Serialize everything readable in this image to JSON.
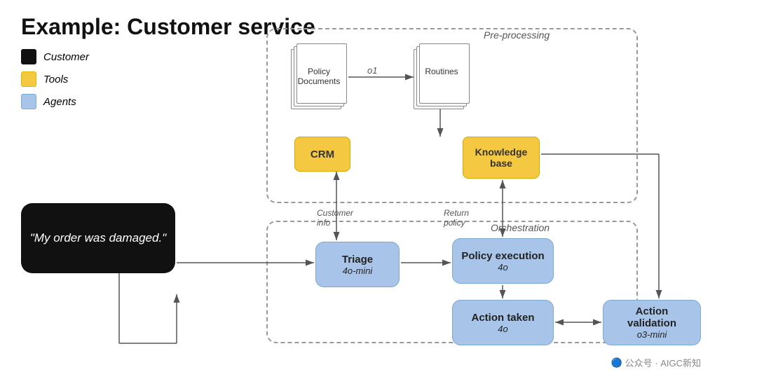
{
  "title": "Example: Customer service",
  "legend": {
    "items": [
      {
        "label": "Customer",
        "color": "black"
      },
      {
        "label": "Tools",
        "color": "yellow"
      },
      {
        "label": "Agents",
        "color": "blue"
      }
    ]
  },
  "customer_message": "\"My order was damaged.\"",
  "preprocessing_label": "Pre-processing",
  "orchestration_label": "Orchestration",
  "policy_documents_label": "Policy\nDocuments",
  "routines_label": "Routines",
  "o1_label": "o1",
  "crm_label": "CRM",
  "knowledge_base_label": "Knowledge\nbase",
  "triage": {
    "name": "Triage",
    "model": "4o-mini"
  },
  "policy_execution": {
    "name": "Policy execution",
    "model": "4o"
  },
  "action_taken": {
    "name": "Action taken",
    "model": "4o"
  },
  "action_validation": {
    "name": "Action validation",
    "model": "o3-mini"
  },
  "customer_info_label": "Customer\ninfo",
  "return_policy_label": "Return\npolicy",
  "watermark": "公众号 · AIGC新知"
}
